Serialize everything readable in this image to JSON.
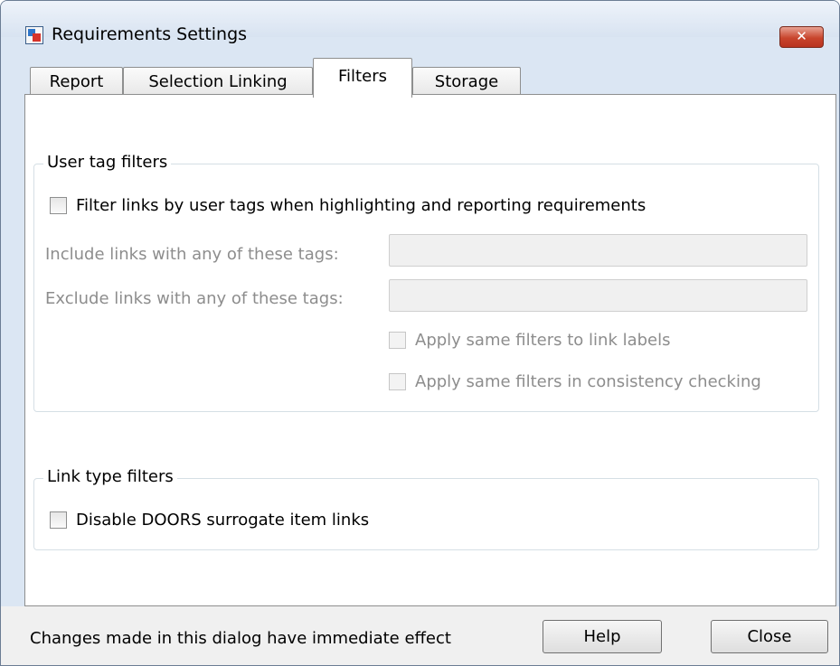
{
  "window": {
    "title": "Requirements Settings",
    "close_glyph": "✕"
  },
  "tabs": [
    {
      "label": "Report"
    },
    {
      "label": "Selection Linking"
    },
    {
      "label": "Filters",
      "active": true
    },
    {
      "label": "Storage"
    }
  ],
  "user_tag_filters": {
    "title": "User tag filters",
    "filter_checkbox_label": "Filter links by user tags when highlighting and reporting requirements",
    "include_label": "Include links with any of these tags:",
    "include_value": "",
    "exclude_label": "Exclude links with any of these tags:",
    "exclude_value": "",
    "apply_link_labels": "Apply same filters to link labels",
    "apply_consistency": "Apply same filters in consistency checking"
  },
  "link_type_filters": {
    "title": "Link type filters",
    "doors_checkbox_label": "Disable DOORS surrogate item links"
  },
  "footer": {
    "status": "Changes made in this dialog have immediate effect",
    "help_label": "Help",
    "close_label": "Close"
  },
  "icons": {
    "app": "requirements-app-icon",
    "close": "close-icon"
  }
}
